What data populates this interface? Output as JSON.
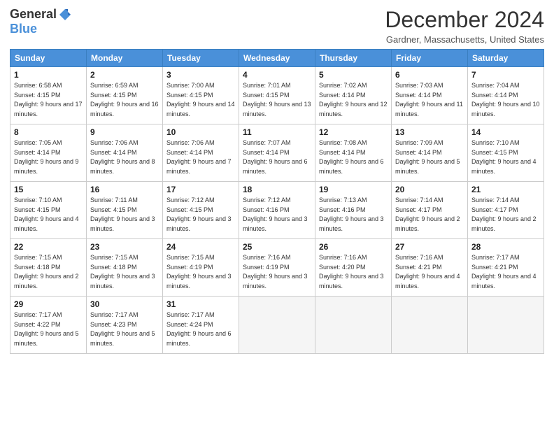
{
  "header": {
    "logo_general": "General",
    "logo_blue": "Blue",
    "title": "December 2024",
    "location": "Gardner, Massachusetts, United States"
  },
  "days_of_week": [
    "Sunday",
    "Monday",
    "Tuesday",
    "Wednesday",
    "Thursday",
    "Friday",
    "Saturday"
  ],
  "weeks": [
    [
      {
        "day": "1",
        "sunrise": "6:58 AM",
        "sunset": "4:15 PM",
        "daylight": "9 hours and 17 minutes."
      },
      {
        "day": "2",
        "sunrise": "6:59 AM",
        "sunset": "4:15 PM",
        "daylight": "9 hours and 16 minutes."
      },
      {
        "day": "3",
        "sunrise": "7:00 AM",
        "sunset": "4:15 PM",
        "daylight": "9 hours and 14 minutes."
      },
      {
        "day": "4",
        "sunrise": "7:01 AM",
        "sunset": "4:15 PM",
        "daylight": "9 hours and 13 minutes."
      },
      {
        "day": "5",
        "sunrise": "7:02 AM",
        "sunset": "4:14 PM",
        "daylight": "9 hours and 12 minutes."
      },
      {
        "day": "6",
        "sunrise": "7:03 AM",
        "sunset": "4:14 PM",
        "daylight": "9 hours and 11 minutes."
      },
      {
        "day": "7",
        "sunrise": "7:04 AM",
        "sunset": "4:14 PM",
        "daylight": "9 hours and 10 minutes."
      }
    ],
    [
      {
        "day": "8",
        "sunrise": "7:05 AM",
        "sunset": "4:14 PM",
        "daylight": "9 hours and 9 minutes."
      },
      {
        "day": "9",
        "sunrise": "7:06 AM",
        "sunset": "4:14 PM",
        "daylight": "9 hours and 8 minutes."
      },
      {
        "day": "10",
        "sunrise": "7:06 AM",
        "sunset": "4:14 PM",
        "daylight": "9 hours and 7 minutes."
      },
      {
        "day": "11",
        "sunrise": "7:07 AM",
        "sunset": "4:14 PM",
        "daylight": "9 hours and 6 minutes."
      },
      {
        "day": "12",
        "sunrise": "7:08 AM",
        "sunset": "4:14 PM",
        "daylight": "9 hours and 6 minutes."
      },
      {
        "day": "13",
        "sunrise": "7:09 AM",
        "sunset": "4:14 PM",
        "daylight": "9 hours and 5 minutes."
      },
      {
        "day": "14",
        "sunrise": "7:10 AM",
        "sunset": "4:15 PM",
        "daylight": "9 hours and 4 minutes."
      }
    ],
    [
      {
        "day": "15",
        "sunrise": "7:10 AM",
        "sunset": "4:15 PM",
        "daylight": "9 hours and 4 minutes."
      },
      {
        "day": "16",
        "sunrise": "7:11 AM",
        "sunset": "4:15 PM",
        "daylight": "9 hours and 3 minutes."
      },
      {
        "day": "17",
        "sunrise": "7:12 AM",
        "sunset": "4:15 PM",
        "daylight": "9 hours and 3 minutes."
      },
      {
        "day": "18",
        "sunrise": "7:12 AM",
        "sunset": "4:16 PM",
        "daylight": "9 hours and 3 minutes."
      },
      {
        "day": "19",
        "sunrise": "7:13 AM",
        "sunset": "4:16 PM",
        "daylight": "9 hours and 3 minutes."
      },
      {
        "day": "20",
        "sunrise": "7:14 AM",
        "sunset": "4:17 PM",
        "daylight": "9 hours and 2 minutes."
      },
      {
        "day": "21",
        "sunrise": "7:14 AM",
        "sunset": "4:17 PM",
        "daylight": "9 hours and 2 minutes."
      }
    ],
    [
      {
        "day": "22",
        "sunrise": "7:15 AM",
        "sunset": "4:18 PM",
        "daylight": "9 hours and 2 minutes."
      },
      {
        "day": "23",
        "sunrise": "7:15 AM",
        "sunset": "4:18 PM",
        "daylight": "9 hours and 3 minutes."
      },
      {
        "day": "24",
        "sunrise": "7:15 AM",
        "sunset": "4:19 PM",
        "daylight": "9 hours and 3 minutes."
      },
      {
        "day": "25",
        "sunrise": "7:16 AM",
        "sunset": "4:19 PM",
        "daylight": "9 hours and 3 minutes."
      },
      {
        "day": "26",
        "sunrise": "7:16 AM",
        "sunset": "4:20 PM",
        "daylight": "9 hours and 3 minutes."
      },
      {
        "day": "27",
        "sunrise": "7:16 AM",
        "sunset": "4:21 PM",
        "daylight": "9 hours and 4 minutes."
      },
      {
        "day": "28",
        "sunrise": "7:17 AM",
        "sunset": "4:21 PM",
        "daylight": "9 hours and 4 minutes."
      }
    ],
    [
      {
        "day": "29",
        "sunrise": "7:17 AM",
        "sunset": "4:22 PM",
        "daylight": "9 hours and 5 minutes."
      },
      {
        "day": "30",
        "sunrise": "7:17 AM",
        "sunset": "4:23 PM",
        "daylight": "9 hours and 5 minutes."
      },
      {
        "day": "31",
        "sunrise": "7:17 AM",
        "sunset": "4:24 PM",
        "daylight": "9 hours and 6 minutes."
      },
      null,
      null,
      null,
      null
    ]
  ],
  "labels": {
    "sunrise_prefix": "Sunrise: ",
    "sunset_prefix": "Sunset: ",
    "daylight_prefix": "Daylight: "
  }
}
